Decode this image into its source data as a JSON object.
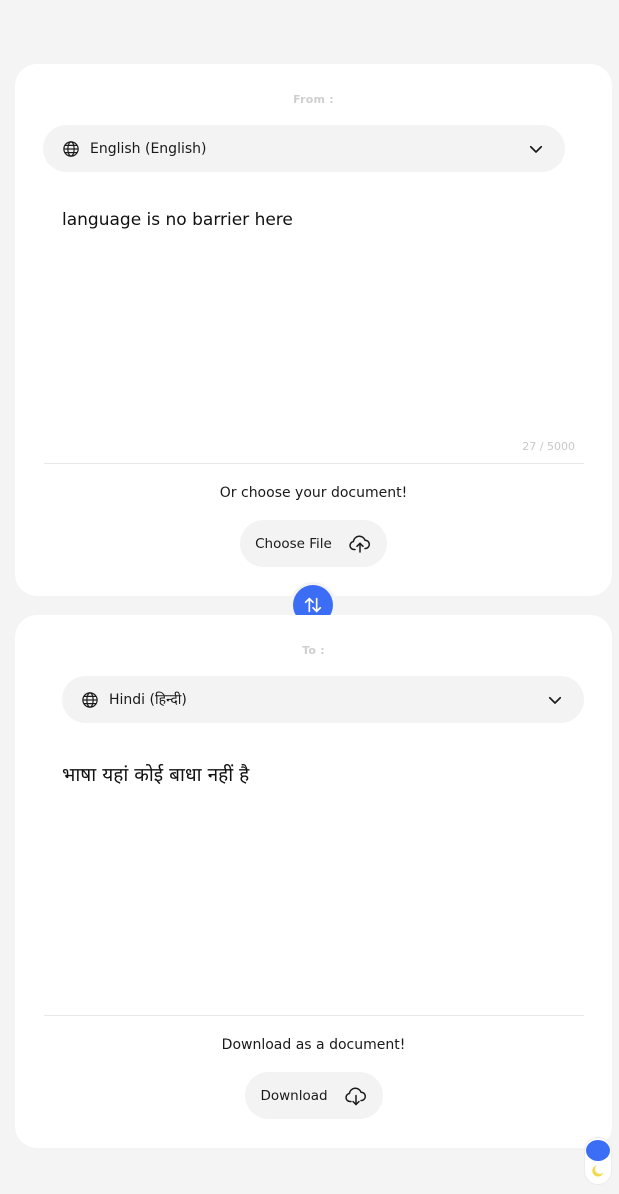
{
  "from": {
    "label": "From :",
    "language": "English (English)",
    "text": "language is no barrier here",
    "char_count": "27 / 5000",
    "helper": "Or choose your document!",
    "button_label": "Choose File",
    "globe_icon": "globe-icon",
    "chevron_icon": "chevron-down-icon",
    "button_icon": "cloud-upload-icon"
  },
  "to": {
    "label": "To :",
    "language": "Hindi (हिन्दी)",
    "text": "भाषा यहां कोई बाधा नहीं है",
    "helper": "Download as a document!",
    "button_label": "Download",
    "globe_icon": "globe-icon",
    "chevron_icon": "chevron-down-icon",
    "button_icon": "cloud-download-icon"
  },
  "swap": {
    "icon": "swap-vertical-icon"
  },
  "theme_toggle": {
    "icon": "moon-icon"
  },
  "colors": {
    "accent": "#3b6ef5",
    "background": "#f4f4f4",
    "card": "#ffffff",
    "pill": "#f3f3f3",
    "muted_text": "#cfcfcf",
    "moon": "#f2d94e"
  }
}
